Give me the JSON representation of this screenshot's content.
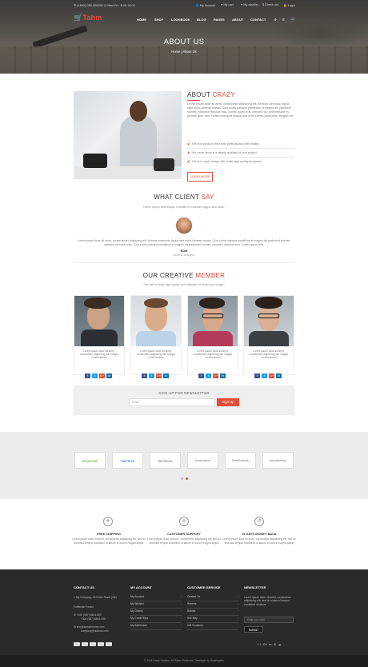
{
  "topbar": {
    "phone": "(+892) 050-300250",
    "hours": "Mon-Fri : 8.00-16.00",
    "links": [
      "My Account",
      "My cart",
      "My wishlist",
      "Check out",
      "Login"
    ]
  },
  "brand": {
    "logo": "Tahm"
  },
  "nav": {
    "items": [
      "HOME",
      "SHOP",
      "LOOKBOOK",
      "BLOG",
      "PAGES",
      "ABOUT",
      "CONTACT"
    ],
    "cart_count": "0"
  },
  "hero": {
    "title": "ABOUT US",
    "breadcrumb": "Home | About Us"
  },
  "about": {
    "title": "ABOUT",
    "title_hl": "CRAZY",
    "paragraph": "Lorem ipsum dolor sit amet, consectetur adipiscing elit. Aenean commodo ligula eget dolor. Aenean massa. Cum sociis natoque penatibus et magnis dis parturient montes, nascetur ridiculus mus. Donec quam felis, ultricies nec, pellentesque eu, pretium quis, sem. Nulla consequat massa quis enim.Donec pede justo, fringilla vel.",
    "checks": [
      "We love produce their best perfectly and that healthy.",
      "We never know is a deeply analysis of your project.",
      "We are create design with really high quality templates."
    ],
    "button": "LEARN MORE"
  },
  "testimonial": {
    "title": "WHAT CLIENT",
    "title_hl": "SAY",
    "subtitle": "Lorem ipsum scelerisque molestie in molestie magna arcu diam.",
    "quote": "Lorem ipsum dolor sit amet, consectetuer adipiscing elit. Aenean commodo ligula eget dolor. Aenean massa. Cum sociis natoque penatibus et magnis dis parturient montes, nascetur ridiculus mus. Cum sociis natoque penatibus et magnis dis parturient montes, nascetur ridiculus mus. Donec quam felis.",
    "name": "BOM",
    "role": "- Graphic designer -"
  },
  "team": {
    "title": "OUR CREATIVE",
    "title_hl": "MEMBER",
    "subtitle": "Our skill is really high quality and standard for build your project",
    "members": [
      {
        "text": "Lorem ipsum dolor sit amet, consectetur adipiscing elit. Integer condimentum"
      },
      {
        "text": "Lorem ipsum dolor sit amet, consectetur adipiscing elit. Integer condimentum"
      },
      {
        "text": "Lorem ipsum dolor sit amet, consectetur adipiscing elit. Integer condimentum"
      },
      {
        "text": "Lorem ipsum dolor sit amet, consectetur adipiscing elit. Integer condimentum"
      }
    ],
    "social": [
      "f",
      "t",
      "G+",
      "in"
    ]
  },
  "newsletter": {
    "title": "SIGN UP FOR NEWSLETTER",
    "placeholder": "Email",
    "button": "Sign Up"
  },
  "brands": [
    "BrightSell",
    "HasTech",
    "devitems",
    "bootexperts",
    "BootExperts",
    "plazathemes"
  ],
  "features": [
    {
      "icon": "airplane-icon",
      "glyph": "✈",
      "title": "FREE SHIPPING",
      "text": "Lorem ipsum dolor sit amet, consectetur adipisicing elit, sed do eiusmod tempor incididunt ut labore et dolore magna aliqua"
    },
    {
      "icon": "support-icon",
      "glyph": "☏",
      "title": "CUSTOMER SUPPORT",
      "text": "Lorem ipsum dolor sit amet, consectetur adipisicing elit, sed do eiusmod tempor incididunt ut labore et dolore magna aliqua"
    },
    {
      "icon": "money-back-icon",
      "glyph": "↺",
      "title": "15 DAYS MONEY BACK",
      "text": "Lorem ipsum dolor sit amet, consectetur adipisicing elit, sed do eiusmod tempor incididunt ut labore et dolore magna aliqua"
    }
  ],
  "footer": {
    "contact": {
      "title": "CONTACT US",
      "address": "My Company, 45 Foffle Street (SE)",
      "city": "Foffleville France",
      "phone1": "+330 (987) 6543-950",
      "phone2": "+302 (987) 6543-958",
      "email1": "info@domainname.com",
      "email2": "company@outlook.com"
    },
    "account": {
      "title": "MY ACCOUNT",
      "items": [
        "My Account",
        "My Wishlist",
        "My Orders",
        "My Credit Slips",
        "My Addresses"
      ]
    },
    "service": {
      "title": "CUSTOMER SERVICE",
      "items": [
        "Contact Us",
        "Returns",
        "Brands",
        "Site Map",
        "Gift Vouchers"
      ]
    },
    "newsletter": {
      "title": "NEWSLETTER",
      "text": "Lorem ipsum dolor sit amet, consectetur adipisicing elit, sed do eiusmod tempor incididunt ut labore",
      "placeholder": "Enter your mail",
      "button": "SUBMIT"
    },
    "social": [
      "f",
      "t",
      "G+",
      "in",
      "◎",
      "☁"
    ],
    "copyright": "© 2015 Crazy Fashion. All Rights Reserved. Developer by Bootexperts"
  },
  "colors": {
    "accent": "#e44d3a",
    "facebook": "#3b5998",
    "twitter": "#1da1f2",
    "google": "#dd4b39",
    "linkedin": "#0e76a8"
  }
}
